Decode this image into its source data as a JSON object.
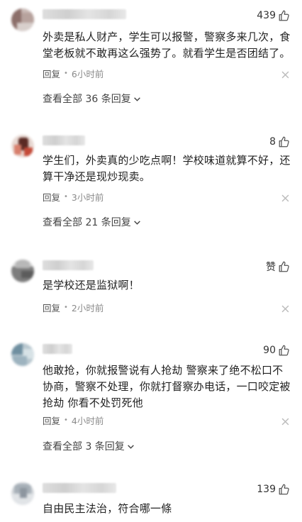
{
  "comments": [
    {
      "likes": "439",
      "text": "外卖是私人财产，学生可以报警，警察多来几次，食堂老板就不敢再这么强势了。就看学生是否团结了。",
      "reply_label": "回复",
      "time": "6小时前",
      "more_label": "查看全部 36 条回复"
    },
    {
      "likes": "8",
      "text": "学生们，外卖真的少吃点啊！学校味道就算不好，还算干净还是现炒现卖。",
      "reply_label": "回复",
      "time": "3小时前",
      "more_label": "查看全部 21 条回复"
    },
    {
      "likes": "赞",
      "text": "是学校还是监狱啊！",
      "reply_label": "回复",
      "time": "2小时前"
    },
    {
      "likes": "90",
      "text": "他敢抢，你就报警说有人抢劫 警察来了绝不松口不协商，警察不处理，你就打督察办电话，一口咬定被抢劫 你看不处罚死他",
      "reply_label": "回复",
      "time": "4小时前",
      "more_label": "查看全部 3 条回复"
    },
    {
      "likes": "139",
      "text": "自由民主法治，符合哪一條"
    }
  ],
  "icons": {
    "like": "thumbs-up-icon",
    "close": "close-icon",
    "expand": "chevron-down-icon"
  },
  "colors": {
    "text": "#222222",
    "meta": "#8a8a8a",
    "icon": "#666666"
  }
}
